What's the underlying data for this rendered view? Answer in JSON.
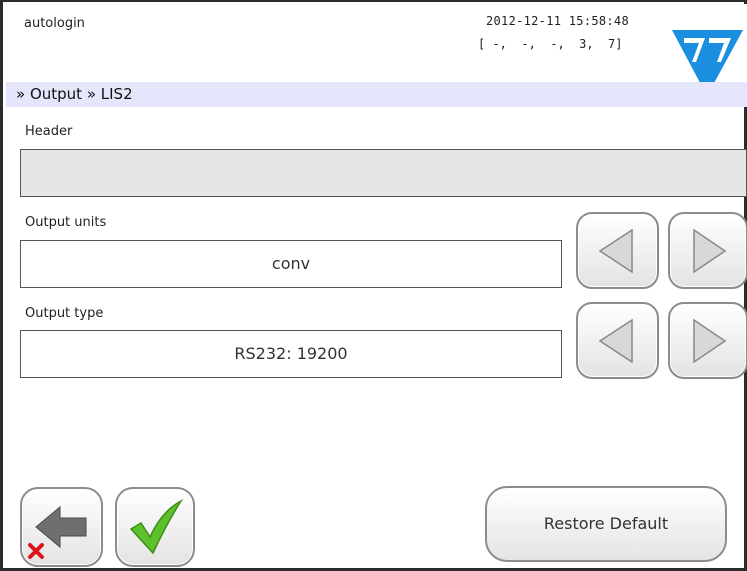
{
  "header": {
    "user": "autologin",
    "datetime": "2012-12-11 15:58:48",
    "codes": "[ -,  -,  -,  3,  7]"
  },
  "breadcrumb": "» Output » LIS2",
  "fields": {
    "header_label": "Header",
    "header_value": "",
    "units_label": "Output units",
    "units_value": "conv",
    "type_label": "Output type",
    "type_value": "RS232: 19200"
  },
  "buttons": {
    "restore_label": "Restore Default"
  },
  "icons": {
    "logo": "77-logo-icon",
    "prev": "triangle-left-icon",
    "next": "triangle-right-icon",
    "back": "back-arrow-cancel-icon",
    "ok": "checkmark-icon"
  },
  "colors": {
    "breadcrumb_bg": "#e5e6fb",
    "logo_blue": "#1a8fe0",
    "check_green": "#5cc12a",
    "cancel_red": "#e0141e"
  }
}
